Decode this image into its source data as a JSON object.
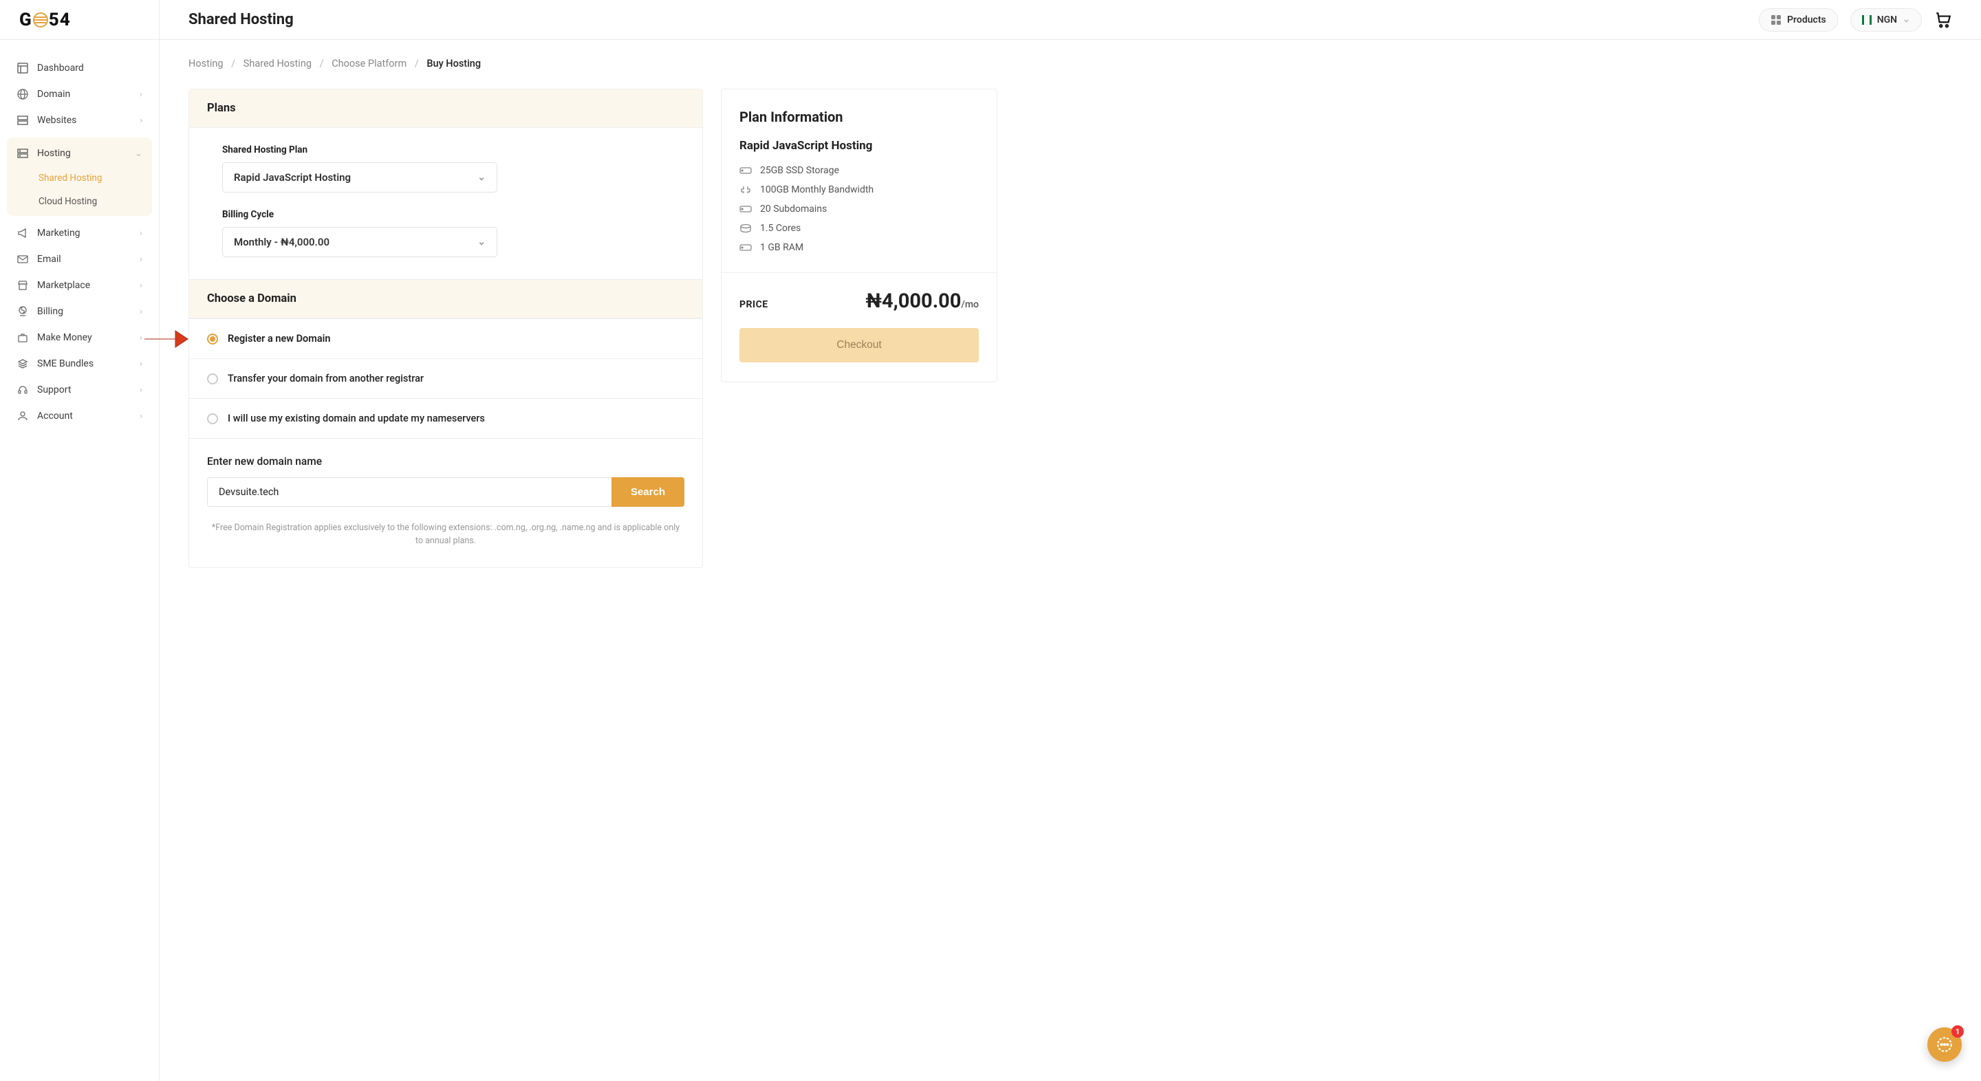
{
  "logo": {
    "text": "GO54"
  },
  "header": {
    "title": "Shared Hosting",
    "products_label": "Products",
    "currency_label": "NGN"
  },
  "sidebar": {
    "items": [
      {
        "label": "Dashboard",
        "expandable": false
      },
      {
        "label": "Domain",
        "expandable": true
      },
      {
        "label": "Websites",
        "expandable": true
      },
      {
        "label": "Hosting",
        "expandable": true,
        "expanded": true,
        "children": [
          {
            "label": "Shared Hosting",
            "active": true
          },
          {
            "label": "Cloud Hosting",
            "active": false
          }
        ]
      },
      {
        "label": "Marketing",
        "expandable": true
      },
      {
        "label": "Email",
        "expandable": true
      },
      {
        "label": "Marketplace",
        "expandable": true
      },
      {
        "label": "Billing",
        "expandable": true
      },
      {
        "label": "Make Money",
        "expandable": true
      },
      {
        "label": "SME Bundles",
        "expandable": true
      },
      {
        "label": "Support",
        "expandable": true
      },
      {
        "label": "Account",
        "expandable": true
      }
    ]
  },
  "breadcrumb": {
    "items": [
      "Hosting",
      "Shared Hosting",
      "Choose Platform",
      "Buy Hosting"
    ]
  },
  "plans": {
    "section_title": "Plans",
    "plan_label": "Shared Hosting Plan",
    "plan_value": "Rapid JavaScript Hosting",
    "billing_label": "Billing Cycle",
    "billing_value": "Monthly - ₦4,000.00"
  },
  "domain_section": {
    "title": "Choose a Domain",
    "options": [
      "Register a new Domain",
      "Transfer your domain from another registrar",
      "I will use my existing domain and update my nameservers"
    ],
    "selected": 0,
    "enter_label": "Enter new domain name",
    "input_value": "Devsuite.tech",
    "search_label": "Search",
    "disclaimer": "*Free Domain Registration applies exclusively to the following extensions: .com.ng, .org.ng, .name.ng and is applicable only to annual plans."
  },
  "plan_info": {
    "title": "Plan Information",
    "plan_name": "Rapid JavaScript Hosting",
    "features": [
      "25GB SSD Storage",
      "100GB Monthly Bandwidth",
      "20 Subdomains",
      "1.5 Cores",
      "1 GB RAM"
    ],
    "price_label": "PRICE",
    "price_value": "₦4,000.00",
    "price_unit": "/mo",
    "checkout_label": "Checkout"
  },
  "chat": {
    "badge": "1"
  }
}
